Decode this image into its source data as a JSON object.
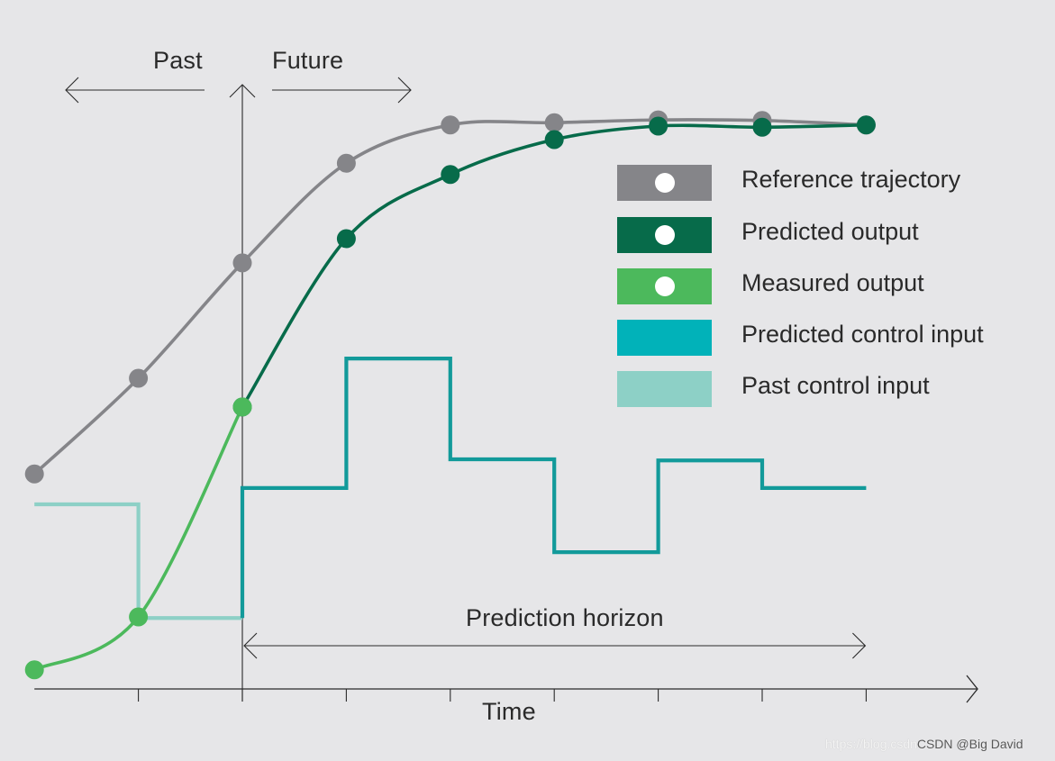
{
  "labels": {
    "past": "Past",
    "future": "Future",
    "prediction_horizon": "Prediction horizon",
    "time": "Time"
  },
  "legend": [
    {
      "label": "Reference trajectory",
      "color": "#858589",
      "marker": true
    },
    {
      "label": "Predicted output",
      "color": "#076b4a",
      "marker": true
    },
    {
      "label": "Measured output",
      "color": "#4cb95c",
      "marker": true
    },
    {
      "label": "Predicted control input",
      "color": "#01b2b9",
      "marker": false
    },
    {
      "label": "Past control input",
      "color": "#8dd0c6",
      "marker": false
    }
  ],
  "watermark": {
    "url_text": "https://blog.csdn.",
    "credit": "CSDN @Big David"
  },
  "chart_data": {
    "type": "line",
    "title": "",
    "xlabel": "Time",
    "ylabel": "",
    "x_ticks": [
      -2,
      -1,
      0,
      1,
      2,
      3,
      4,
      5,
      6
    ],
    "current_time": 0,
    "prediction_horizon": [
      0,
      6
    ],
    "ylim": [
      0,
      110
    ],
    "grid": false,
    "legend_position": "right",
    "series": [
      {
        "name": "Reference trajectory",
        "kind": "smooth",
        "color": "#858589",
        "x": [
          -2,
          -1,
          0,
          1,
          2,
          3,
          4,
          5,
          6
        ],
        "y": [
          38.2,
          55.2,
          75.7,
          93.4,
          100.2,
          100.6,
          101.1,
          101.0,
          100.2
        ]
      },
      {
        "name": "Predicted output",
        "kind": "smooth",
        "color": "#076b4a",
        "x": [
          0,
          1,
          2,
          3,
          4,
          5,
          6
        ],
        "y": [
          50.1,
          80.0,
          91.4,
          97.6,
          100.0,
          99.8,
          100.2
        ]
      },
      {
        "name": "Measured output",
        "kind": "smooth",
        "color": "#4cb95c",
        "x": [
          -2,
          -1,
          0
        ],
        "y": [
          3.4,
          12.8,
          50.1
        ]
      },
      {
        "name": "Predicted control input",
        "kind": "step",
        "color": "#129a9a",
        "x": [
          0,
          1,
          2,
          3,
          4,
          5,
          6
        ],
        "y": [
          35.7,
          58.7,
          40.8,
          24.3,
          40.6,
          35.7
        ]
      },
      {
        "name": "Past control input",
        "kind": "step",
        "color": "#8dd0c6",
        "x": [
          -2,
          -1,
          0
        ],
        "y": [
          32.8,
          12.6
        ]
      }
    ]
  }
}
